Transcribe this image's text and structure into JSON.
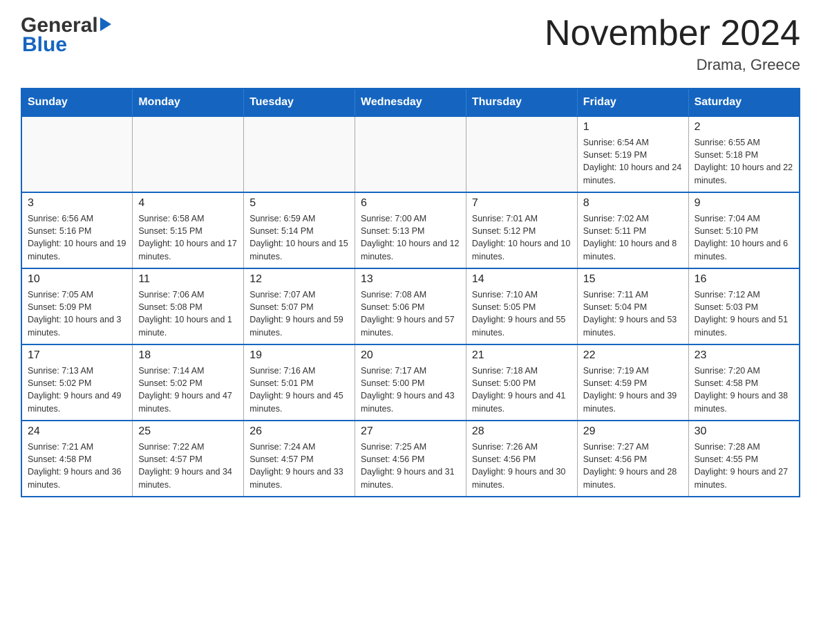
{
  "header": {
    "month_year": "November 2024",
    "location": "Drama, Greece",
    "logo_general": "General",
    "logo_blue": "Blue"
  },
  "weekdays": [
    "Sunday",
    "Monday",
    "Tuesday",
    "Wednesday",
    "Thursday",
    "Friday",
    "Saturday"
  ],
  "weeks": [
    [
      {
        "day": "",
        "sunrise": "",
        "sunset": "",
        "daylight": ""
      },
      {
        "day": "",
        "sunrise": "",
        "sunset": "",
        "daylight": ""
      },
      {
        "day": "",
        "sunrise": "",
        "sunset": "",
        "daylight": ""
      },
      {
        "day": "",
        "sunrise": "",
        "sunset": "",
        "daylight": ""
      },
      {
        "day": "",
        "sunrise": "",
        "sunset": "",
        "daylight": ""
      },
      {
        "day": "1",
        "sunrise": "Sunrise: 6:54 AM",
        "sunset": "Sunset: 5:19 PM",
        "daylight": "Daylight: 10 hours and 24 minutes."
      },
      {
        "day": "2",
        "sunrise": "Sunrise: 6:55 AM",
        "sunset": "Sunset: 5:18 PM",
        "daylight": "Daylight: 10 hours and 22 minutes."
      }
    ],
    [
      {
        "day": "3",
        "sunrise": "Sunrise: 6:56 AM",
        "sunset": "Sunset: 5:16 PM",
        "daylight": "Daylight: 10 hours and 19 minutes."
      },
      {
        "day": "4",
        "sunrise": "Sunrise: 6:58 AM",
        "sunset": "Sunset: 5:15 PM",
        "daylight": "Daylight: 10 hours and 17 minutes."
      },
      {
        "day": "5",
        "sunrise": "Sunrise: 6:59 AM",
        "sunset": "Sunset: 5:14 PM",
        "daylight": "Daylight: 10 hours and 15 minutes."
      },
      {
        "day": "6",
        "sunrise": "Sunrise: 7:00 AM",
        "sunset": "Sunset: 5:13 PM",
        "daylight": "Daylight: 10 hours and 12 minutes."
      },
      {
        "day": "7",
        "sunrise": "Sunrise: 7:01 AM",
        "sunset": "Sunset: 5:12 PM",
        "daylight": "Daylight: 10 hours and 10 minutes."
      },
      {
        "day": "8",
        "sunrise": "Sunrise: 7:02 AM",
        "sunset": "Sunset: 5:11 PM",
        "daylight": "Daylight: 10 hours and 8 minutes."
      },
      {
        "day": "9",
        "sunrise": "Sunrise: 7:04 AM",
        "sunset": "Sunset: 5:10 PM",
        "daylight": "Daylight: 10 hours and 6 minutes."
      }
    ],
    [
      {
        "day": "10",
        "sunrise": "Sunrise: 7:05 AM",
        "sunset": "Sunset: 5:09 PM",
        "daylight": "Daylight: 10 hours and 3 minutes."
      },
      {
        "day": "11",
        "sunrise": "Sunrise: 7:06 AM",
        "sunset": "Sunset: 5:08 PM",
        "daylight": "Daylight: 10 hours and 1 minute."
      },
      {
        "day": "12",
        "sunrise": "Sunrise: 7:07 AM",
        "sunset": "Sunset: 5:07 PM",
        "daylight": "Daylight: 9 hours and 59 minutes."
      },
      {
        "day": "13",
        "sunrise": "Sunrise: 7:08 AM",
        "sunset": "Sunset: 5:06 PM",
        "daylight": "Daylight: 9 hours and 57 minutes."
      },
      {
        "day": "14",
        "sunrise": "Sunrise: 7:10 AM",
        "sunset": "Sunset: 5:05 PM",
        "daylight": "Daylight: 9 hours and 55 minutes."
      },
      {
        "day": "15",
        "sunrise": "Sunrise: 7:11 AM",
        "sunset": "Sunset: 5:04 PM",
        "daylight": "Daylight: 9 hours and 53 minutes."
      },
      {
        "day": "16",
        "sunrise": "Sunrise: 7:12 AM",
        "sunset": "Sunset: 5:03 PM",
        "daylight": "Daylight: 9 hours and 51 minutes."
      }
    ],
    [
      {
        "day": "17",
        "sunrise": "Sunrise: 7:13 AM",
        "sunset": "Sunset: 5:02 PM",
        "daylight": "Daylight: 9 hours and 49 minutes."
      },
      {
        "day": "18",
        "sunrise": "Sunrise: 7:14 AM",
        "sunset": "Sunset: 5:02 PM",
        "daylight": "Daylight: 9 hours and 47 minutes."
      },
      {
        "day": "19",
        "sunrise": "Sunrise: 7:16 AM",
        "sunset": "Sunset: 5:01 PM",
        "daylight": "Daylight: 9 hours and 45 minutes."
      },
      {
        "day": "20",
        "sunrise": "Sunrise: 7:17 AM",
        "sunset": "Sunset: 5:00 PM",
        "daylight": "Daylight: 9 hours and 43 minutes."
      },
      {
        "day": "21",
        "sunrise": "Sunrise: 7:18 AM",
        "sunset": "Sunset: 5:00 PM",
        "daylight": "Daylight: 9 hours and 41 minutes."
      },
      {
        "day": "22",
        "sunrise": "Sunrise: 7:19 AM",
        "sunset": "Sunset: 4:59 PM",
        "daylight": "Daylight: 9 hours and 39 minutes."
      },
      {
        "day": "23",
        "sunrise": "Sunrise: 7:20 AM",
        "sunset": "Sunset: 4:58 PM",
        "daylight": "Daylight: 9 hours and 38 minutes."
      }
    ],
    [
      {
        "day": "24",
        "sunrise": "Sunrise: 7:21 AM",
        "sunset": "Sunset: 4:58 PM",
        "daylight": "Daylight: 9 hours and 36 minutes."
      },
      {
        "day": "25",
        "sunrise": "Sunrise: 7:22 AM",
        "sunset": "Sunset: 4:57 PM",
        "daylight": "Daylight: 9 hours and 34 minutes."
      },
      {
        "day": "26",
        "sunrise": "Sunrise: 7:24 AM",
        "sunset": "Sunset: 4:57 PM",
        "daylight": "Daylight: 9 hours and 33 minutes."
      },
      {
        "day": "27",
        "sunrise": "Sunrise: 7:25 AM",
        "sunset": "Sunset: 4:56 PM",
        "daylight": "Daylight: 9 hours and 31 minutes."
      },
      {
        "day": "28",
        "sunrise": "Sunrise: 7:26 AM",
        "sunset": "Sunset: 4:56 PM",
        "daylight": "Daylight: 9 hours and 30 minutes."
      },
      {
        "day": "29",
        "sunrise": "Sunrise: 7:27 AM",
        "sunset": "Sunset: 4:56 PM",
        "daylight": "Daylight: 9 hours and 28 minutes."
      },
      {
        "day": "30",
        "sunrise": "Sunrise: 7:28 AM",
        "sunset": "Sunset: 4:55 PM",
        "daylight": "Daylight: 9 hours and 27 minutes."
      }
    ]
  ]
}
